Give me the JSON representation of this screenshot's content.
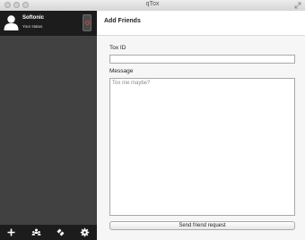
{
  "window": {
    "title": "qTox"
  },
  "profile": {
    "name": "Softonic",
    "status": "Your status"
  },
  "header": {
    "title": "Add Friends"
  },
  "form": {
    "toxid_label": "Tox ID",
    "toxid_value": "",
    "message_label": "Message",
    "message_placeholder": "Tox me maybe?",
    "send_label": "Send friend request"
  },
  "toolbar": {
    "icons": [
      "add-friend-icon",
      "group-icon",
      "transfers-icon",
      "settings-icon"
    ]
  },
  "colors": {
    "sidebar": "#414141",
    "profile_bar": "#1c1c1c",
    "status_ring": "#c84a4a",
    "content_bg": "#f6f6f6"
  }
}
